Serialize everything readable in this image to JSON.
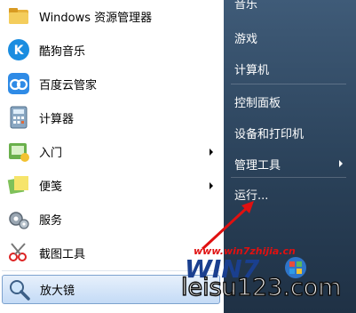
{
  "left_items": [
    {
      "label": "Windows 资源管理器",
      "icon": "folder-icon"
    },
    {
      "label": "酷狗音乐",
      "icon": "kugou-icon"
    },
    {
      "label": "百度云管家",
      "icon": "baidu-cloud-icon"
    },
    {
      "label": "计算器",
      "icon": "calculator-icon"
    },
    {
      "label": "入门",
      "icon": "getting-started-icon",
      "submenu": true
    },
    {
      "label": "便笺",
      "icon": "sticky-notes-icon",
      "submenu": true
    },
    {
      "label": "服务",
      "icon": "services-icon"
    },
    {
      "label": "截图工具",
      "icon": "snipping-tool-icon"
    },
    {
      "label": "放大镜",
      "icon": "magnifier-icon",
      "selected": true
    }
  ],
  "right_items": [
    {
      "label": "音乐"
    },
    {
      "label": "游戏"
    },
    {
      "label": "计算机"
    },
    {
      "label": "控制面板"
    },
    {
      "label": "设备和打印机"
    },
    {
      "label": "管理工具",
      "submenu": true
    },
    {
      "label": "运行..."
    }
  ],
  "watermark": {
    "url": "www.win7zhijia.cn",
    "logo_text": "WIN7",
    "site": "leisu123.com"
  },
  "colors": {
    "accent_red": "#e01010",
    "right_panel": "#2a4159",
    "selection": "#c4dbf6"
  }
}
